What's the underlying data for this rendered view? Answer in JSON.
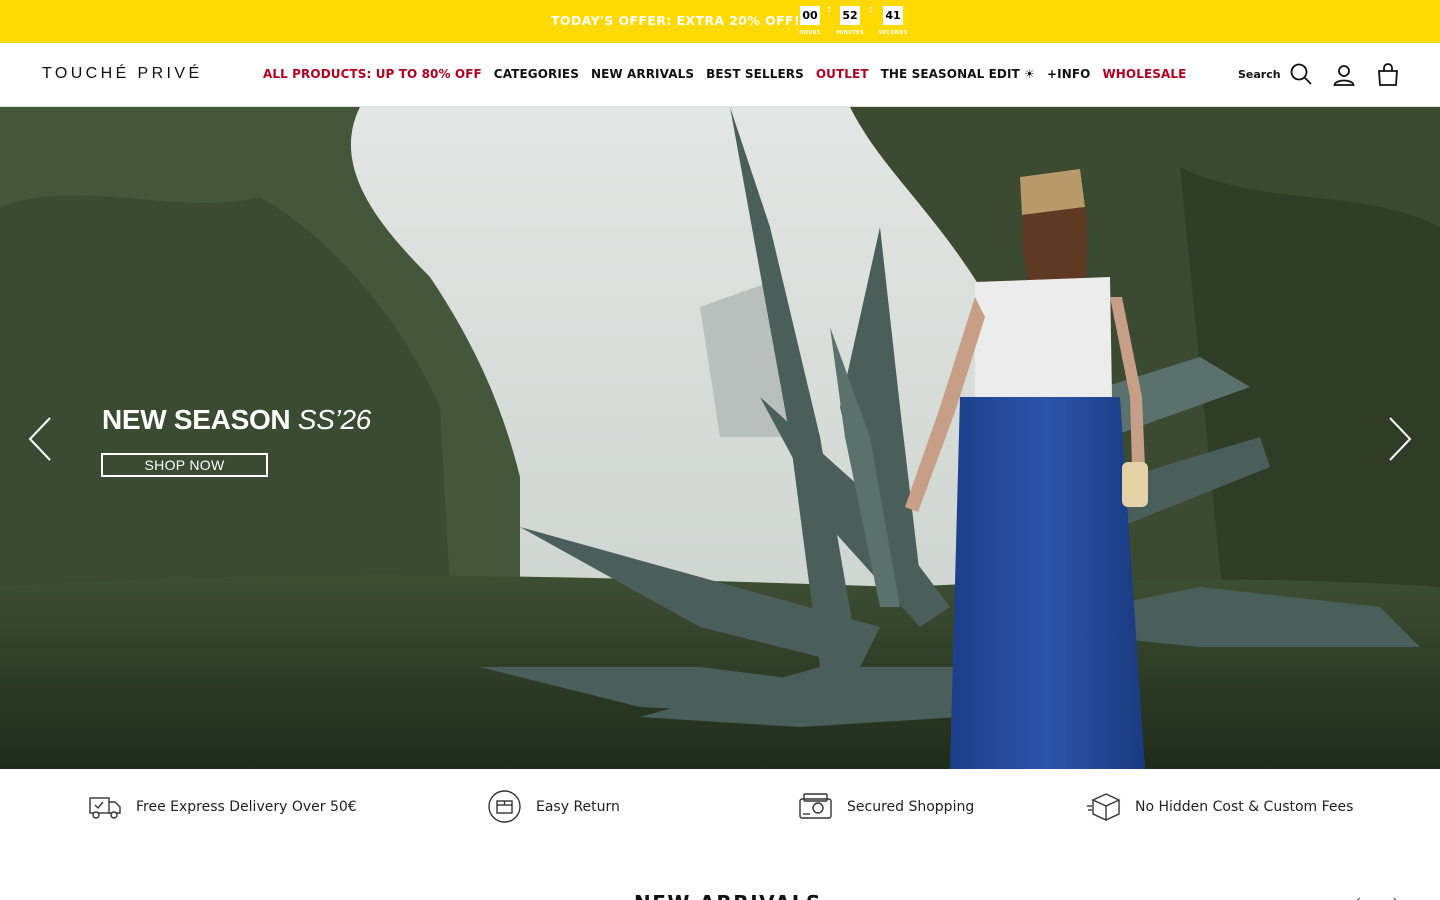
{
  "announcement": {
    "text": "TODAY'S OFFER: EXTRA 20% OFF!",
    "countdown": {
      "hours": "00",
      "hours_label": "HOURS",
      "minutes": "52",
      "minutes_label": "MINUTES",
      "seconds": "41",
      "seconds_label": "SECONDS"
    }
  },
  "header": {
    "logo": "TOUCHÉ PRIVÉ",
    "nav": [
      {
        "label": "ALL PRODUCTS: UP TO 80% OFF",
        "highlight": true
      },
      {
        "label": "CATEGORIES",
        "highlight": false
      },
      {
        "label": "NEW ARRIVALS",
        "highlight": false
      },
      {
        "label": "BEST SELLERS",
        "highlight": false
      },
      {
        "label": "OUTLET",
        "highlight": true
      },
      {
        "label": "THE SEASONAL EDIT ☀",
        "highlight": false
      },
      {
        "label": "+INFO",
        "highlight": false
      },
      {
        "label": "WHOLESALE",
        "highlight": true
      }
    ],
    "search_label": "Search",
    "icons": [
      "search-icon",
      "account-icon",
      "cart-icon"
    ]
  },
  "hero": {
    "title_main": "NEW SEASON",
    "title_season": "SS’26",
    "cta": "SHOP NOW",
    "icons": [
      "chevron-left-icon",
      "chevron-right-icon"
    ]
  },
  "features": [
    {
      "label": "Free Express Delivery Over 50€",
      "icon": "delivery-truck-icon"
    },
    {
      "label": "Easy Return",
      "icon": "return-box-icon"
    },
    {
      "label": "Secured Shopping",
      "icon": "secure-payment-icon"
    },
    {
      "label": "No Hidden Cost & Custom Fees",
      "icon": "package-icon"
    }
  ],
  "next_section": {
    "title": "NEW ARRIVALS",
    "arrows": "‹ ›"
  },
  "colors": {
    "announcement_bg": "#ffd902",
    "sale_red": "#b2001f",
    "text": "#111111"
  }
}
